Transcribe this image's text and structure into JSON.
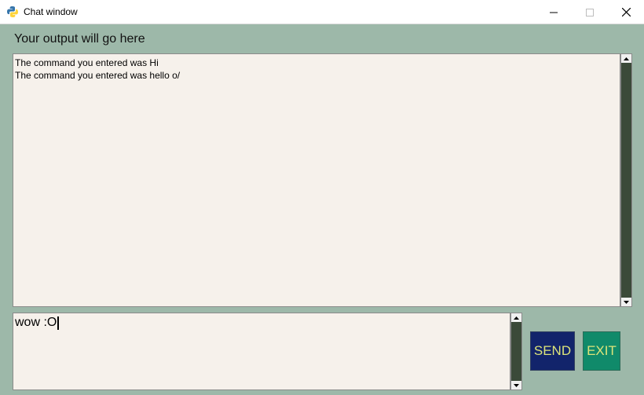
{
  "window": {
    "title": "Chat window",
    "icon": "python-icon",
    "controls": [
      "minimize-icon",
      "maximize-icon",
      "close-icon"
    ]
  },
  "output": {
    "label": "Your output will go here",
    "lines": [
      "The command you entered was Hi",
      "The command you entered was hello o/"
    ]
  },
  "input": {
    "value": "wow :O"
  },
  "buttons": {
    "send": "SEND",
    "exit": "EXIT"
  },
  "colors": {
    "background": "#9db8a9",
    "textbox": "#f6f1eb",
    "scrollbar": "#3b4a39",
    "send_button": "#12246b",
    "exit_button": "#108a6a",
    "button_text": "#dde47a"
  }
}
